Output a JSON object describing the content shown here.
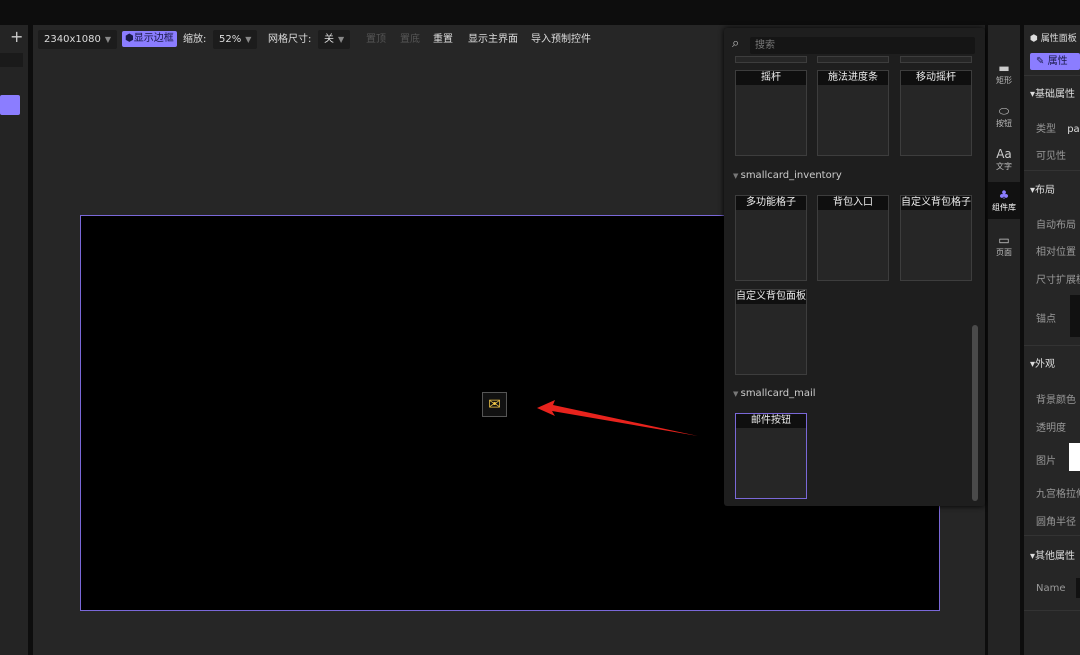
{
  "left_panel": {
    "add_label": "+"
  },
  "toolbar": {
    "resolution": "2340x1080",
    "show_border": "显示边框",
    "zoom_label": "缩放:",
    "zoom_value": "52%",
    "grid_label": "网格尺寸:",
    "grid_value": "关",
    "top": "置顶",
    "bottom": "置底",
    "reset": "重置",
    "show_main": "显示主界面",
    "import": "导入预制控件"
  },
  "component_popup": {
    "search_placeholder": "搜索",
    "row1": [
      "摇杆",
      "施法进度条",
      "移动摇杆"
    ],
    "sections": [
      {
        "name": "smallcard_inventory",
        "items": [
          "多功能格子",
          "背包入口",
          "自定义背包格子",
          "自定义背包面板"
        ]
      },
      {
        "name": "smallcard_mail",
        "items": [
          "邮件按钮"
        ]
      }
    ]
  },
  "tool_strip": [
    {
      "label": "矩形",
      "icon": "rectangle-icon"
    },
    {
      "label": "按钮",
      "icon": "button-icon"
    },
    {
      "label": "文字",
      "icon": "text-icon"
    },
    {
      "label": "组件库",
      "icon": "component-library-icon"
    },
    {
      "label": "页面",
      "icon": "page-icon"
    }
  ],
  "properties": {
    "title": "属性面板",
    "tab": "属性",
    "basic": "基础属性",
    "type_label": "类型",
    "type_value": "pa",
    "visible": "可见性",
    "layout": "布局",
    "auto_layout": "自动布局",
    "relative": "相对位置",
    "size_expand": "尺寸扩展模",
    "anchor": "锚点",
    "appearance": "外观",
    "bg_color": "背景颜色",
    "opacity": "透明度",
    "image": "图片",
    "nine_slice": "九宫格拉伸",
    "radius": "圆角半径",
    "other": "其他属性",
    "name_label": "Name"
  },
  "colors": {
    "accent": "#8b7dff",
    "frame_border": "#7a68d8",
    "arrow": "#e8231d"
  }
}
